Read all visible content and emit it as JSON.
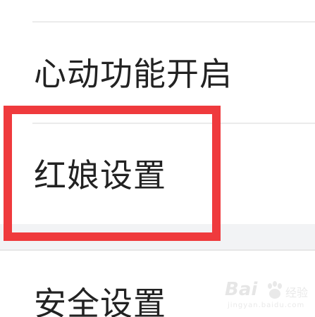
{
  "settings_list": {
    "items": [
      {
        "label": "心动功能开启"
      },
      {
        "label": "红娘设置"
      },
      {
        "label": "安全设置"
      }
    ]
  },
  "watermark": {
    "logo_text": "Bai",
    "logo_text_cn": "经验",
    "sub_text": "jingyan.baidu.com"
  },
  "colors": {
    "highlight": "#ef3a3d",
    "section_bg": "#f2f3f5",
    "text": "#222222"
  }
}
